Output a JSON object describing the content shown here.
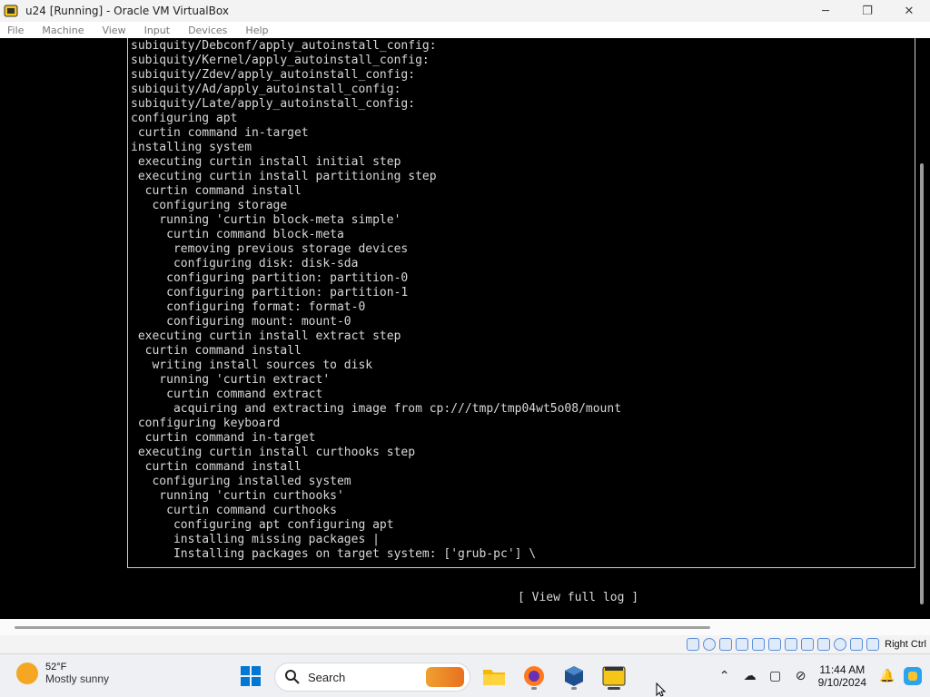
{
  "window": {
    "title": "u24 [Running] - Oracle VM VirtualBox",
    "controls": {
      "minimize": "─",
      "maximize": "❐",
      "close": "✕"
    }
  },
  "menubar": {
    "items": [
      "File",
      "Machine",
      "View",
      "Input",
      "Devices",
      "Help"
    ]
  },
  "terminal": {
    "lines": [
      "subiquity/Debconf/apply_autoinstall_config:",
      "subiquity/Kernel/apply_autoinstall_config:",
      "subiquity/Zdev/apply_autoinstall_config:",
      "subiquity/Ad/apply_autoinstall_config:",
      "subiquity/Late/apply_autoinstall_config:",
      "configuring apt",
      " curtin command in-target",
      "installing system",
      " executing curtin install initial step",
      " executing curtin install partitioning step",
      "  curtin command install",
      "   configuring storage",
      "    running 'curtin block-meta simple'",
      "     curtin command block-meta",
      "      removing previous storage devices",
      "      configuring disk: disk-sda",
      "     configuring partition: partition-0",
      "     configuring partition: partition-1",
      "     configuring format: format-0",
      "     configuring mount: mount-0",
      " executing curtin install extract step",
      "  curtin command install",
      "   writing install sources to disk",
      "    running 'curtin extract'",
      "     curtin command extract",
      "      acquiring and extracting image from cp:///tmp/tmp04wt5o08/mount",
      " configuring keyboard",
      "  curtin command in-target",
      " executing curtin install curthooks step",
      "  curtin command install",
      "   configuring installed system",
      "    running 'curtin curthooks'",
      "     curtin command curthooks",
      "      configuring apt configuring apt",
      "      installing missing packages |",
      "      Installing packages on target system: ['grub-pc'] \\"
    ],
    "view_log_button": "[ View full log ]"
  },
  "statusbar": {
    "host_key": "Right Ctrl"
  },
  "taskbar": {
    "weather": {
      "temp": "52°F",
      "desc": "Mostly sunny"
    },
    "search": {
      "label": "Search"
    },
    "clock": {
      "time": "11:44 AM",
      "date": "9/10/2024"
    }
  },
  "colors": {
    "terminal_bg": "#000000",
    "terminal_fg": "#d8d8d8",
    "taskbar_bg": "#eef0f4",
    "windows_blue": "#0078d4"
  }
}
